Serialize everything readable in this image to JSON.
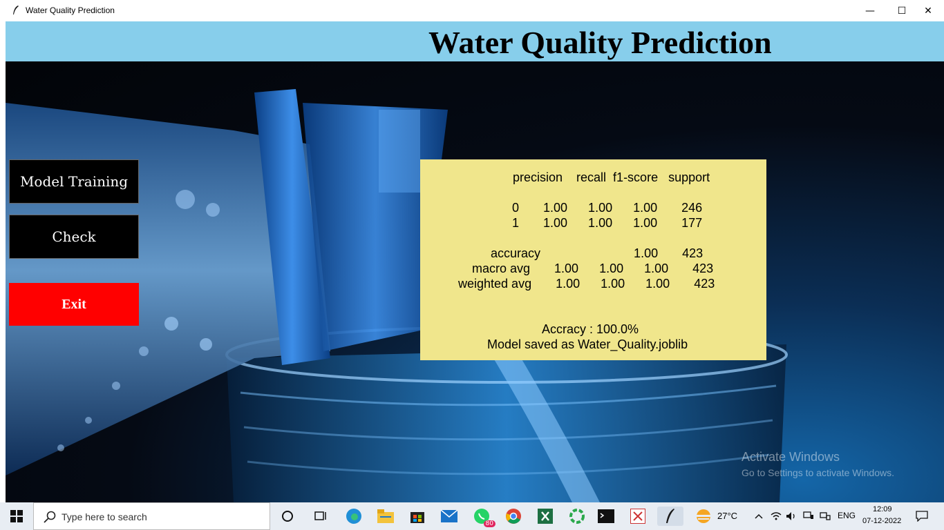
{
  "window": {
    "title": "Water Quality Prediction",
    "minimize_glyph": "—",
    "maximize_glyph": "☐",
    "close_glyph": "✕"
  },
  "header": {
    "title": "Water Quality Prediction"
  },
  "buttons": {
    "model_training": "Model Training",
    "check": "Check",
    "exit": "Exit"
  },
  "report": {
    "header_row": "precision    recall  f1-score   support",
    "rows": [
      "0       1.00      1.00      1.00       246",
      "1       1.00      1.00      1.00       177"
    ],
    "accuracy_row": "accuracy                           1.00       423",
    "macro_row": "macro avg       1.00      1.00      1.00       423",
    "weighted_row": "weighted avg       1.00      1.00      1.00       423",
    "accuracy_text": "Accracy : 100.0%",
    "saved_text": "Model saved as Water_Quality.joblib"
  },
  "watermark": {
    "line1": "Activate Windows",
    "line2": "Go to Settings to activate Windows."
  },
  "taskbar": {
    "search_placeholder": "Type here to search",
    "whatsapp_badge": "80",
    "weather_temp": "27°C",
    "language": "ENG",
    "time": "12:09",
    "date": "07-12-2022"
  },
  "colors": {
    "header_bg": "#87ceeb",
    "panel_bg": "#f0e68c",
    "exit_bg": "#ff0000",
    "button_bg": "#000000"
  },
  "icons": [
    "feather-icon",
    "windows-start-icon",
    "search-icon",
    "cortana-icon",
    "task-view-icon",
    "edge-icon",
    "file-explorer-icon",
    "store-icon",
    "mail-icon",
    "whatsapp-icon",
    "chrome-icon",
    "excel-icon",
    "app-icon",
    "terminal-icon",
    "tool-icon",
    "python-feather-icon",
    "weather-icon",
    "chevron-up-icon",
    "wifi-icon",
    "volume-icon",
    "notification-icon"
  ]
}
